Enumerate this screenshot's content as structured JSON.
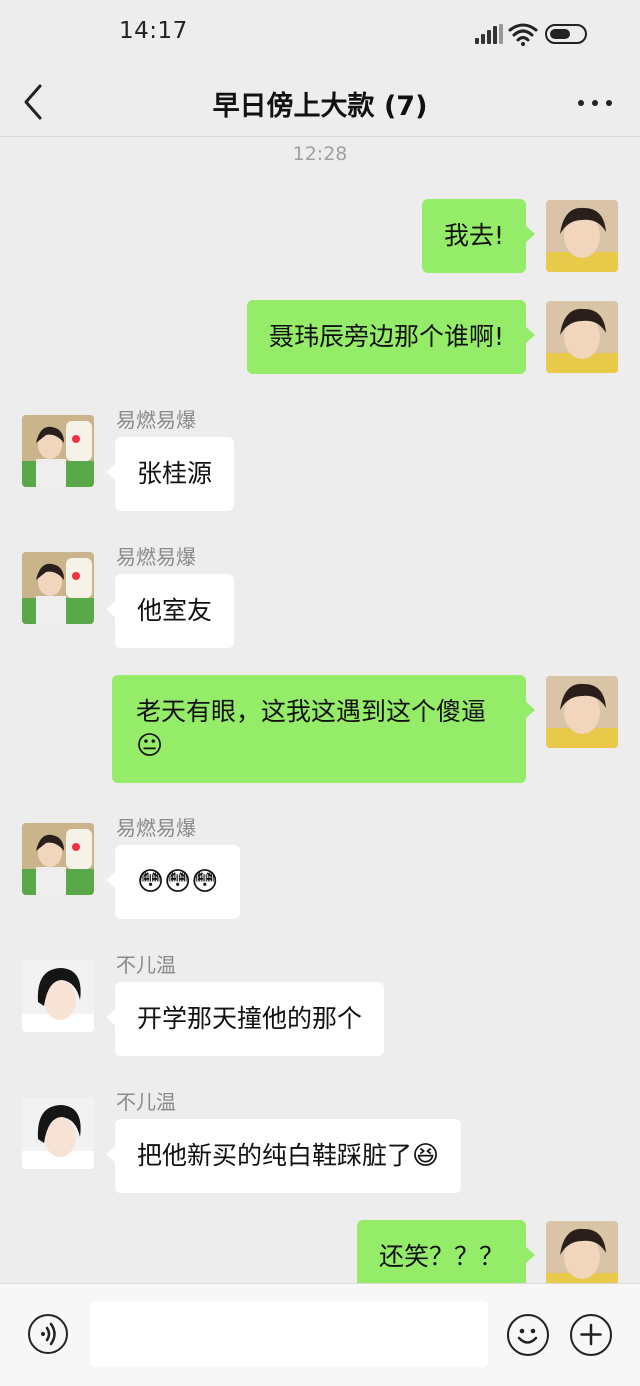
{
  "status_bar": {
    "time": "14:17",
    "icons": [
      "signal-icon",
      "wifi-icon",
      "battery-icon"
    ]
  },
  "nav": {
    "title": "早日傍上大款 (7)",
    "back_icon": "back-chevron-icon",
    "more_icon": "more-dots-icon"
  },
  "chat": {
    "timestamp": "12:28",
    "messages": [
      {
        "from": "me",
        "text": "我去!"
      },
      {
        "from": "me",
        "text": "聂玮辰旁边那个谁啊!"
      },
      {
        "from": "other",
        "sender": "易燃易爆",
        "text": "张桂源"
      },
      {
        "from": "other",
        "sender": "易燃易爆",
        "text": "他室友"
      },
      {
        "from": "me",
        "text": "老天有眼，这我这遇到这个傻逼",
        "emoji": "😐"
      },
      {
        "from": "other",
        "sender": "易燃易爆",
        "text": "",
        "emoji": "😳😳😳"
      },
      {
        "from": "other",
        "sender": "不儿温",
        "text": "开学那天撞他的那个"
      },
      {
        "from": "other",
        "sender": "不儿温",
        "text": "把他新买的纯白鞋踩脏了",
        "emoji": "😆"
      },
      {
        "from": "me",
        "text": "还笑？？？"
      }
    ]
  },
  "input_bar": {
    "voice_icon": "voice-icon",
    "placeholder": "",
    "emoji_icon": "emoji-face-icon",
    "plus_icon": "plus-icon"
  },
  "colors": {
    "background": "#ededed",
    "outgoing_bubble": "#95ec69",
    "incoming_bubble": "#ffffff",
    "accent_text": "#111111"
  }
}
